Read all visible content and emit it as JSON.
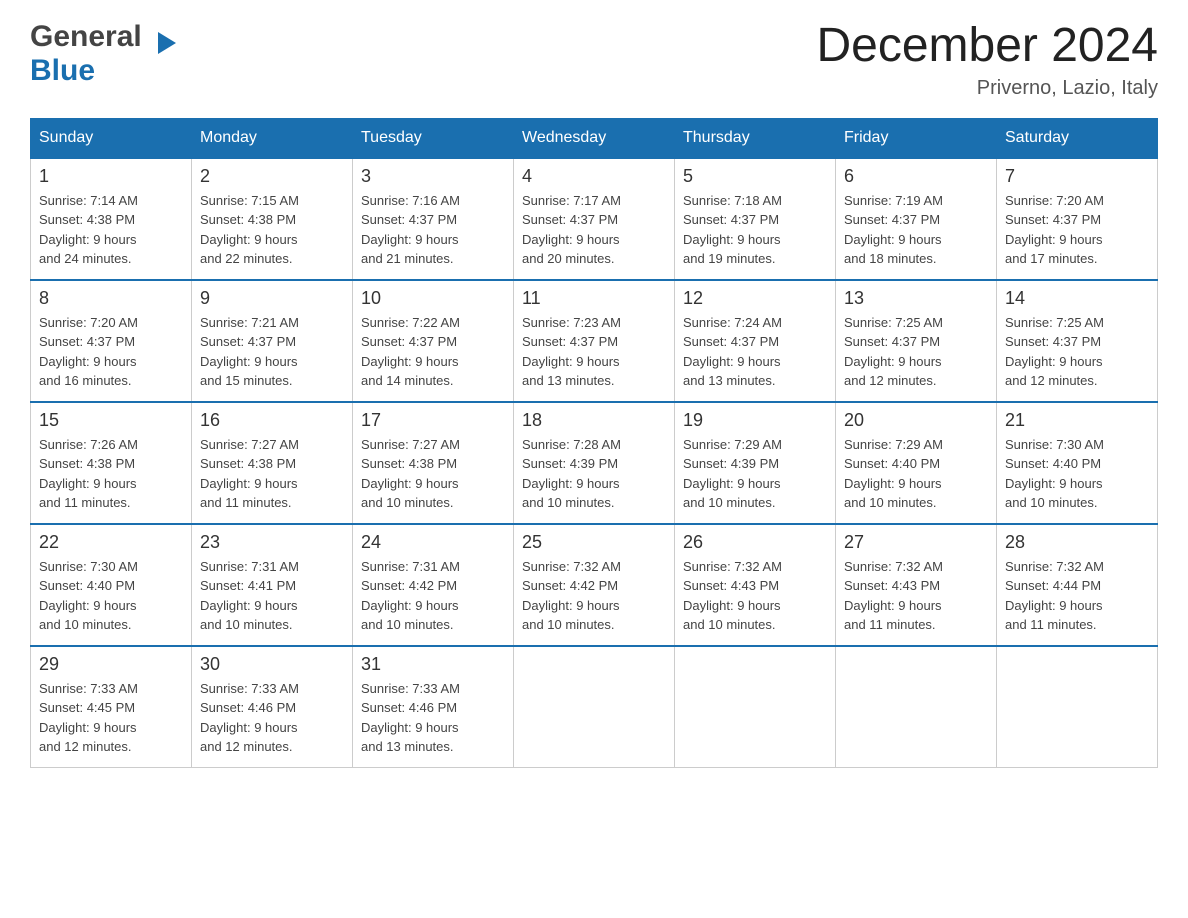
{
  "header": {
    "logo_general": "General",
    "logo_blue": "Blue",
    "month_title": "December 2024",
    "location": "Priverno, Lazio, Italy"
  },
  "weekdays": [
    "Sunday",
    "Monday",
    "Tuesday",
    "Wednesday",
    "Thursday",
    "Friday",
    "Saturday"
  ],
  "weeks": [
    [
      {
        "day": "1",
        "sunrise": "7:14 AM",
        "sunset": "4:38 PM",
        "daylight": "9 hours and 24 minutes."
      },
      {
        "day": "2",
        "sunrise": "7:15 AM",
        "sunset": "4:38 PM",
        "daylight": "9 hours and 22 minutes."
      },
      {
        "day": "3",
        "sunrise": "7:16 AM",
        "sunset": "4:37 PM",
        "daylight": "9 hours and 21 minutes."
      },
      {
        "day": "4",
        "sunrise": "7:17 AM",
        "sunset": "4:37 PM",
        "daylight": "9 hours and 20 minutes."
      },
      {
        "day": "5",
        "sunrise": "7:18 AM",
        "sunset": "4:37 PM",
        "daylight": "9 hours and 19 minutes."
      },
      {
        "day": "6",
        "sunrise": "7:19 AM",
        "sunset": "4:37 PM",
        "daylight": "9 hours and 18 minutes."
      },
      {
        "day": "7",
        "sunrise": "7:20 AM",
        "sunset": "4:37 PM",
        "daylight": "9 hours and 17 minutes."
      }
    ],
    [
      {
        "day": "8",
        "sunrise": "7:20 AM",
        "sunset": "4:37 PM",
        "daylight": "9 hours and 16 minutes."
      },
      {
        "day": "9",
        "sunrise": "7:21 AM",
        "sunset": "4:37 PM",
        "daylight": "9 hours and 15 minutes."
      },
      {
        "day": "10",
        "sunrise": "7:22 AM",
        "sunset": "4:37 PM",
        "daylight": "9 hours and 14 minutes."
      },
      {
        "day": "11",
        "sunrise": "7:23 AM",
        "sunset": "4:37 PM",
        "daylight": "9 hours and 13 minutes."
      },
      {
        "day": "12",
        "sunrise": "7:24 AM",
        "sunset": "4:37 PM",
        "daylight": "9 hours and 13 minutes."
      },
      {
        "day": "13",
        "sunrise": "7:25 AM",
        "sunset": "4:37 PM",
        "daylight": "9 hours and 12 minutes."
      },
      {
        "day": "14",
        "sunrise": "7:25 AM",
        "sunset": "4:37 PM",
        "daylight": "9 hours and 12 minutes."
      }
    ],
    [
      {
        "day": "15",
        "sunrise": "7:26 AM",
        "sunset": "4:38 PM",
        "daylight": "9 hours and 11 minutes."
      },
      {
        "day": "16",
        "sunrise": "7:27 AM",
        "sunset": "4:38 PM",
        "daylight": "9 hours and 11 minutes."
      },
      {
        "day": "17",
        "sunrise": "7:27 AM",
        "sunset": "4:38 PM",
        "daylight": "9 hours and 10 minutes."
      },
      {
        "day": "18",
        "sunrise": "7:28 AM",
        "sunset": "4:39 PM",
        "daylight": "9 hours and 10 minutes."
      },
      {
        "day": "19",
        "sunrise": "7:29 AM",
        "sunset": "4:39 PM",
        "daylight": "9 hours and 10 minutes."
      },
      {
        "day": "20",
        "sunrise": "7:29 AM",
        "sunset": "4:40 PM",
        "daylight": "9 hours and 10 minutes."
      },
      {
        "day": "21",
        "sunrise": "7:30 AM",
        "sunset": "4:40 PM",
        "daylight": "9 hours and 10 minutes."
      }
    ],
    [
      {
        "day": "22",
        "sunrise": "7:30 AM",
        "sunset": "4:40 PM",
        "daylight": "9 hours and 10 minutes."
      },
      {
        "day": "23",
        "sunrise": "7:31 AM",
        "sunset": "4:41 PM",
        "daylight": "9 hours and 10 minutes."
      },
      {
        "day": "24",
        "sunrise": "7:31 AM",
        "sunset": "4:42 PM",
        "daylight": "9 hours and 10 minutes."
      },
      {
        "day": "25",
        "sunrise": "7:32 AM",
        "sunset": "4:42 PM",
        "daylight": "9 hours and 10 minutes."
      },
      {
        "day": "26",
        "sunrise": "7:32 AM",
        "sunset": "4:43 PM",
        "daylight": "9 hours and 10 minutes."
      },
      {
        "day": "27",
        "sunrise": "7:32 AM",
        "sunset": "4:43 PM",
        "daylight": "9 hours and 11 minutes."
      },
      {
        "day": "28",
        "sunrise": "7:32 AM",
        "sunset": "4:44 PM",
        "daylight": "9 hours and 11 minutes."
      }
    ],
    [
      {
        "day": "29",
        "sunrise": "7:33 AM",
        "sunset": "4:45 PM",
        "daylight": "9 hours and 12 minutes."
      },
      {
        "day": "30",
        "sunrise": "7:33 AM",
        "sunset": "4:46 PM",
        "daylight": "9 hours and 12 minutes."
      },
      {
        "day": "31",
        "sunrise": "7:33 AM",
        "sunset": "4:46 PM",
        "daylight": "9 hours and 13 minutes."
      },
      null,
      null,
      null,
      null
    ]
  ]
}
